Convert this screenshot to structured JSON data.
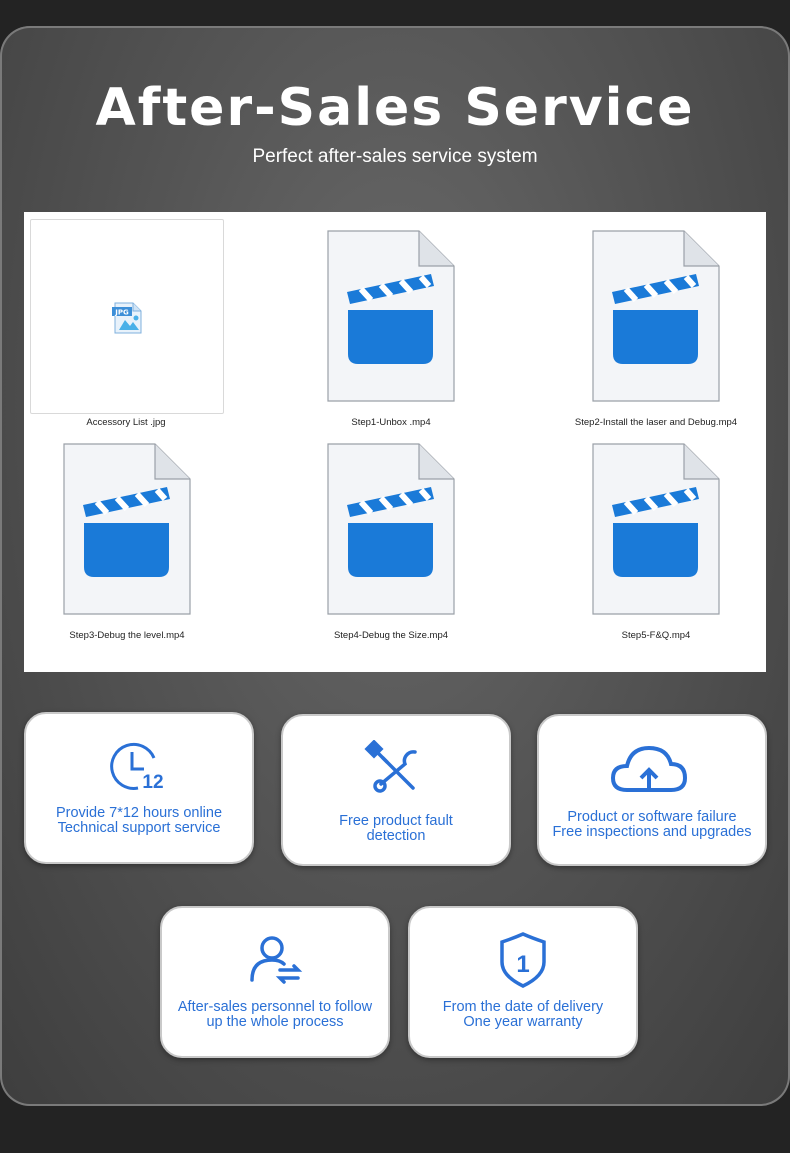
{
  "header": {
    "title": "After-Sales Service",
    "subtitle": "Perfect after-sales service system"
  },
  "files": [
    {
      "name": "Accessory List .jpg",
      "type": "jpg",
      "badge": "JPG"
    },
    {
      "name": "Step1-Unbox .mp4",
      "type": "video"
    },
    {
      "name": "Step2-Install the laser and Debug.mp4",
      "type": "video"
    },
    {
      "name": "Step3-Debug the level.mp4",
      "type": "video"
    },
    {
      "name": "Step4-Debug the Size.mp4",
      "type": "video"
    },
    {
      "name": "Step5-F&Q.mp4",
      "type": "video"
    }
  ],
  "services": [
    {
      "icon": "clock-12-icon",
      "icon_text": "12",
      "line1": "Provide 7*12 hours online",
      "line2": "Technical support service"
    },
    {
      "icon": "wrench-screwdriver-icon",
      "line1": "Free product fault",
      "line2": "detection"
    },
    {
      "icon": "cloud-upload-icon",
      "line1": "Product or software failure",
      "line2": "Free inspections and upgrades"
    },
    {
      "icon": "person-transfer-icon",
      "line1": "After-sales personnel to follow",
      "line2": "up the whole process"
    },
    {
      "icon": "shield-one-icon",
      "icon_text": "1",
      "line1": "From the date of delivery",
      "line2": "One year warranty"
    }
  ],
  "colors": {
    "accent": "#2a70d6",
    "video_icon": "#1a7ad8",
    "background": "#232323"
  }
}
